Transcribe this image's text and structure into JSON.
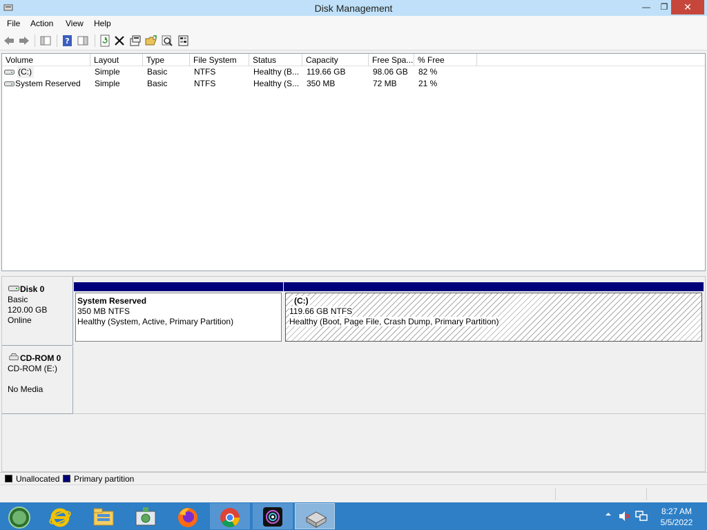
{
  "window": {
    "title": "Disk Management",
    "minimize_icon": "minimize-icon",
    "maximize_icon": "restore-icon",
    "close_icon": "close-icon"
  },
  "menu": {
    "items": [
      "File",
      "Action",
      "View",
      "Help"
    ]
  },
  "toolbar": {
    "buttons": [
      "back-icon",
      "forward-icon",
      "show-hide-console-tree-icon",
      "help-icon",
      "show-hide-action-pane-icon",
      "refresh-icon",
      "delete-icon",
      "properties-icon",
      "open-icon",
      "explore-icon",
      "help-topics-icon"
    ]
  },
  "volume_list": {
    "columns": [
      "Volume",
      "Layout",
      "Type",
      "File System",
      "Status",
      "Capacity",
      "Free Spa...",
      "% Free"
    ],
    "rows": [
      {
        "volume": "(C:)",
        "layout": "Simple",
        "type": "Basic",
        "fs": "NTFS",
        "status": "Healthy (B...",
        "capacity": "119.66 GB",
        "free": "98.06 GB",
        "pct": "82 %"
      },
      {
        "volume": "System Reserved",
        "layout": "Simple",
        "type": "Basic",
        "fs": "NTFS",
        "status": "Healthy (S...",
        "capacity": "350 MB",
        "free": "72 MB",
        "pct": "21 %"
      }
    ]
  },
  "disks": {
    "disk0": {
      "name": "Disk 0",
      "type": "Basic",
      "size": "120.00 GB",
      "state": "Online",
      "partitions": [
        {
          "name": "System Reserved",
          "size": "350 MB NTFS",
          "status": "Healthy (System, Active, Primary Partition)"
        },
        {
          "name": "(C:)",
          "size": "119.66 GB NTFS",
          "status": "Healthy (Boot, Page File, Crash Dump, Primary Partition)"
        }
      ]
    },
    "cdrom0": {
      "name": "CD-ROM 0",
      "drive": "CD-ROM (E:)",
      "media": "No Media"
    }
  },
  "legend": {
    "items": [
      {
        "label": "Unallocated",
        "color": "#000000"
      },
      {
        "label": "Primary partition",
        "color": "#00007b"
      }
    ]
  },
  "taskbar": {
    "items": [
      "start-orb-icon",
      "internet-explorer-icon",
      "file-explorer-icon",
      "control-panel-icon",
      "firefox-icon",
      "chrome-icon",
      "media-app-icon",
      "disk-management-icon"
    ],
    "tray": [
      "show-hidden-icons-icon",
      "volume-muted-icon",
      "network-icon"
    ],
    "time": "8:27 AM",
    "date": "5/5/2022"
  }
}
